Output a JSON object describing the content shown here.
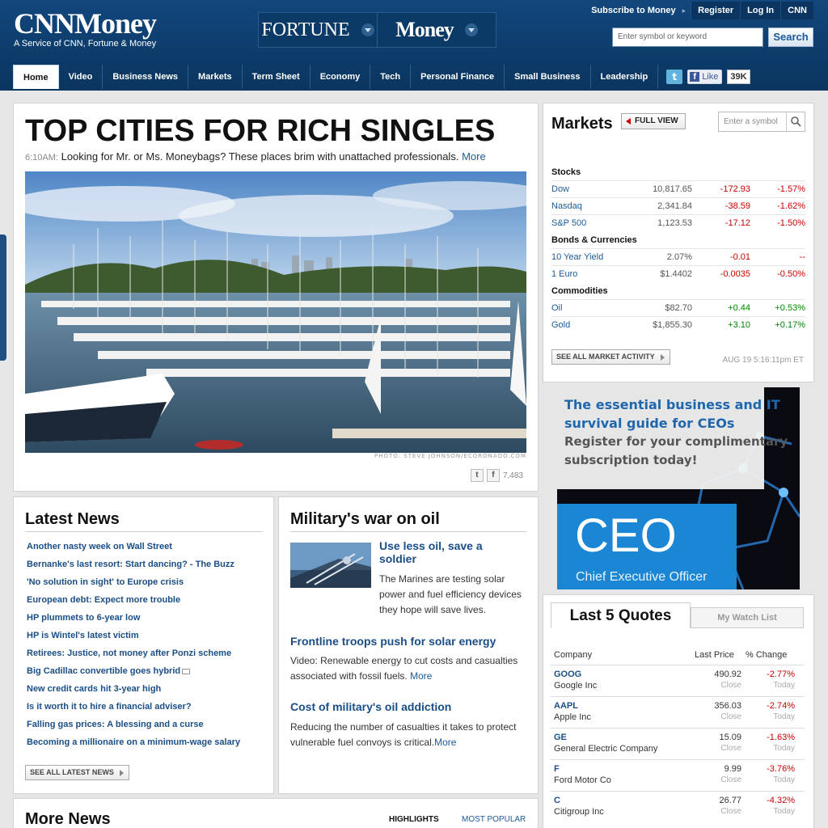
{
  "brand": {
    "logo_cnn": "CNN",
    "logo_money": "Money",
    "tagline": "A Service of CNN, Fortune & Money",
    "fortune": "FORTUNE",
    "money": "Money"
  },
  "toplinks": {
    "subscribe": "Subscribe to Money",
    "register": "Register",
    "login": "Log In",
    "cnn": "CNN"
  },
  "search": {
    "placeholder": "Enter symbol or keyword",
    "button": "Search"
  },
  "nav": [
    "Home",
    "Video",
    "Business News",
    "Markets",
    "Term Sheet",
    "Economy",
    "Tech",
    "Personal Finance",
    "Small Business",
    "Leadership"
  ],
  "social": {
    "fb_like": "Like",
    "fb_count": "39K"
  },
  "hero": {
    "title": "TOP CITIES FOR RICH SINGLES",
    "time": "6:10AM:",
    "dek": "Looking for Mr. or Ms. Moneybags? These places brim with unattached professionals.",
    "more": "More",
    "credit": "PHOTO: STEVE JOHNSON/ECORONADO.COM",
    "share_count": "7,483"
  },
  "markets": {
    "title": "Markets",
    "full_view": "FULL VIEW",
    "symbol_placeholder": "Enter a symbol",
    "sections": [
      {
        "heading": "Stocks",
        "rows": [
          {
            "name": "Dow",
            "value": "10,817.65",
            "change": "-172.93",
            "pct": "-1.57%",
            "dir": "neg"
          },
          {
            "name": "Nasdaq",
            "value": "2,341.84",
            "change": "-38.59",
            "pct": "-1.62%",
            "dir": "neg"
          },
          {
            "name": "S&P 500",
            "value": "1,123.53",
            "change": "-17.12",
            "pct": "-1.50%",
            "dir": "neg"
          }
        ]
      },
      {
        "heading": "Bonds & Currencies",
        "rows": [
          {
            "name": "10 Year Yield",
            "value": "2.07%",
            "change": "-0.01",
            "pct": "--",
            "dir": "neg"
          },
          {
            "name": "1 Euro",
            "value": "$1.4402",
            "change": "-0.0035",
            "pct": "-0.50%",
            "dir": "neg"
          }
        ]
      },
      {
        "heading": "Commodities",
        "rows": [
          {
            "name": "Oil",
            "value": "$82.70",
            "change": "+0.44",
            "pct": "+0.53%",
            "dir": "pos"
          },
          {
            "name": "Gold",
            "value": "$1,855.30",
            "change": "+3.10",
            "pct": "+0.17%",
            "dir": "pos"
          }
        ]
      }
    ],
    "see_all": "SEE ALL MARKET ACTIVITY",
    "timestamp": "AUG 19 5:16:11pm ET"
  },
  "ad": {
    "line1": "The essential business and IT",
    "line2": "survival guide for CEOs",
    "line3": "Register for your complimentary",
    "line4": "subscription today!",
    "ceo": "CEO",
    "ceo_sub": "Chief Executive Officer"
  },
  "latest": {
    "title": "Latest News",
    "items": [
      "Another nasty week on Wall Street",
      "Bernanke's last resort: Start dancing? - The Buzz",
      "'No solution in sight' to Europe crisis",
      "European debt: Expect more trouble",
      "HP plummets to 6-year low",
      "HP is Wintel's latest victim",
      "Retirees: Justice, not money after Ponzi scheme",
      "Big Cadillac convertible goes hybrid",
      "New credit cards hit 3-year high",
      "Is it worth it to hire a financial adviser?",
      "Falling gas prices: A blessing and a curse",
      "Becoming a millionaire on a minimum-wage salary"
    ],
    "see_all": "SEE ALL LATEST NEWS"
  },
  "military": {
    "title": "Military's war on oil",
    "lead_head": "Use less oil, save a soldier",
    "lead_body": "The Marines are testing solar power and fuel efficiency devices they hope will save lives.",
    "s2_head": "Frontline troops push for solar energy",
    "s2_body": "Video: Renewable energy to cut costs and casualties associated with fossil fuels.",
    "s3_head": "Cost of military's oil addiction",
    "s3_body": "Reducing the number of casualties it takes to protect vulnerable fuel convoys is critical.",
    "more": "More"
  },
  "quotes": {
    "tab_active": "Last 5 Quotes",
    "tab_other": "My Watch List",
    "col_company": "Company",
    "col_price": "Last Price",
    "col_change": "% Change",
    "rows": [
      {
        "sym": "GOOG",
        "name": "Google Inc",
        "price": "490.92",
        "pct": "-2.77%"
      },
      {
        "sym": "AAPL",
        "name": "Apple Inc",
        "price": "356.03",
        "pct": "-2.74%"
      },
      {
        "sym": "GE",
        "name": "General Electric Company",
        "price": "15.09",
        "pct": "-1.63%"
      },
      {
        "sym": "F",
        "name": "Ford Motor Co",
        "price": "9.99",
        "pct": "-3.76%"
      },
      {
        "sym": "C",
        "name": "Citigroup Inc",
        "price": "26.77",
        "pct": "-4.32%"
      }
    ],
    "close": "Close",
    "today": "Today"
  },
  "more_news": {
    "title": "More News",
    "tab1": "HIGHLIGHTS",
    "tab2": "MOST POPULAR"
  },
  "colors": {
    "header": "#0a355f",
    "link": "#1a4e86",
    "negative": "#cc0000",
    "positive": "#008800"
  }
}
